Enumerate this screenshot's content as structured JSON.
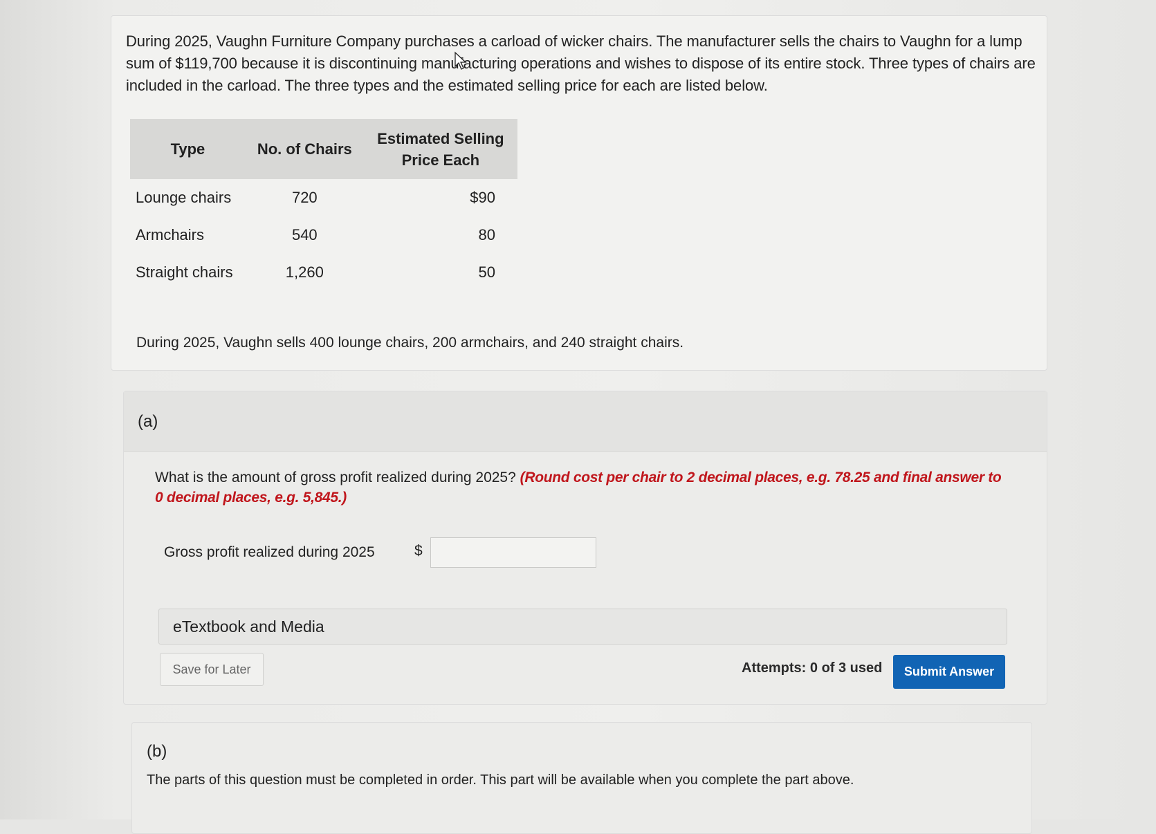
{
  "problem": {
    "intro": "During 2025, Vaughn Furniture Company purchases a carload of wicker chairs. The manufacturer sells the chairs to Vaughn for a lump sum of $119,700 because it is discontinuing manufacturing operations and wishes to dispose of its entire stock. Three types of chairs are included in the carload. The three types and the estimated selling price for each are listed below.",
    "table": {
      "headers": {
        "type": "Type",
        "count": "No. of Chairs",
        "price_line1": "Estimated Selling",
        "price_line2": "Price Each"
      },
      "rows": [
        {
          "type": "Lounge chairs",
          "count": "720",
          "price": "$90"
        },
        {
          "type": "Armchairs",
          "count": "540",
          "price": "80"
        },
        {
          "type": "Straight chairs",
          "count": "1,260",
          "price": "50"
        }
      ]
    },
    "sales": "During 2025, Vaughn sells 400 lounge chairs, 200 armchairs, and 240 straight chairs."
  },
  "part_a": {
    "label": "(a)",
    "question": "What is the amount of gross profit realized during 2025?",
    "instruction": "(Round cost per chair to 2 decimal places, e.g. 78.25 and final answer to 0 decimal places, e.g. 5,845.)",
    "field_label": "Gross profit realized during 2025",
    "currency": "$",
    "answer_value": "",
    "etextbook": "eTextbook and Media",
    "save_label": "Save for Later",
    "attempts": "Attempts: 0 of 3 used",
    "submit_label": "Submit Answer"
  },
  "part_b": {
    "label": "(b)",
    "note": "The parts of this question must be completed in order. This part will be available when you complete the part above."
  },
  "colors": {
    "submit_bg": "#1164b4",
    "instruction_red": "#c0161c"
  },
  "icons": {
    "mouse_cursor": "arrow-pointer-icon"
  }
}
